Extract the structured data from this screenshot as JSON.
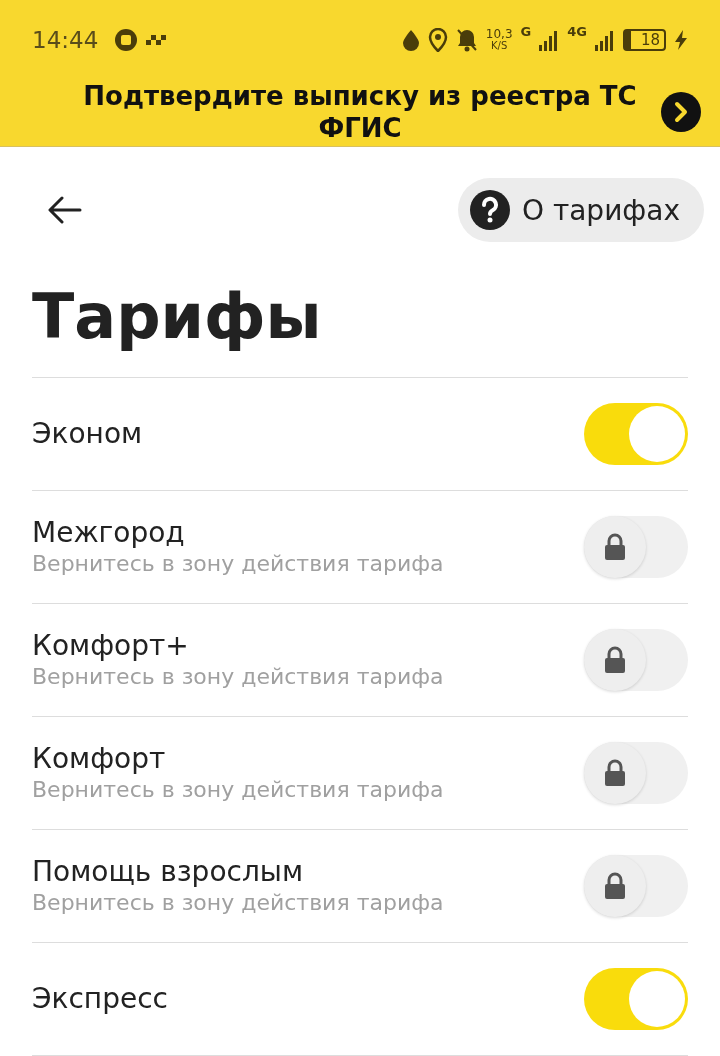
{
  "status_bar": {
    "time": "14:44",
    "speed": "10,3",
    "speed_unit": "K/S",
    "network_1": "G",
    "network_2": "4G",
    "battery": "18"
  },
  "banner": {
    "text": "Подтвердите выписку из реестра ТС ФГИС"
  },
  "about_button": {
    "label": "О тарифах"
  },
  "title": "Тарифы",
  "tariffs": [
    {
      "name": "Эконом",
      "on": true,
      "locked": false
    },
    {
      "name": "Межгород",
      "subtitle": "Вернитесь в зону действия тарифа",
      "on": false,
      "locked": true
    },
    {
      "name": "Комфорт+",
      "subtitle": "Вернитесь в зону действия тарифа",
      "on": false,
      "locked": true
    },
    {
      "name": "Комфорт",
      "subtitle": "Вернитесь в зону действия тарифа",
      "on": false,
      "locked": true
    },
    {
      "name": "Помощь взрослым",
      "subtitle": "Вернитесь в зону действия тарифа",
      "on": false,
      "locked": true
    },
    {
      "name": "Экспресс",
      "on": true,
      "locked": false
    }
  ]
}
